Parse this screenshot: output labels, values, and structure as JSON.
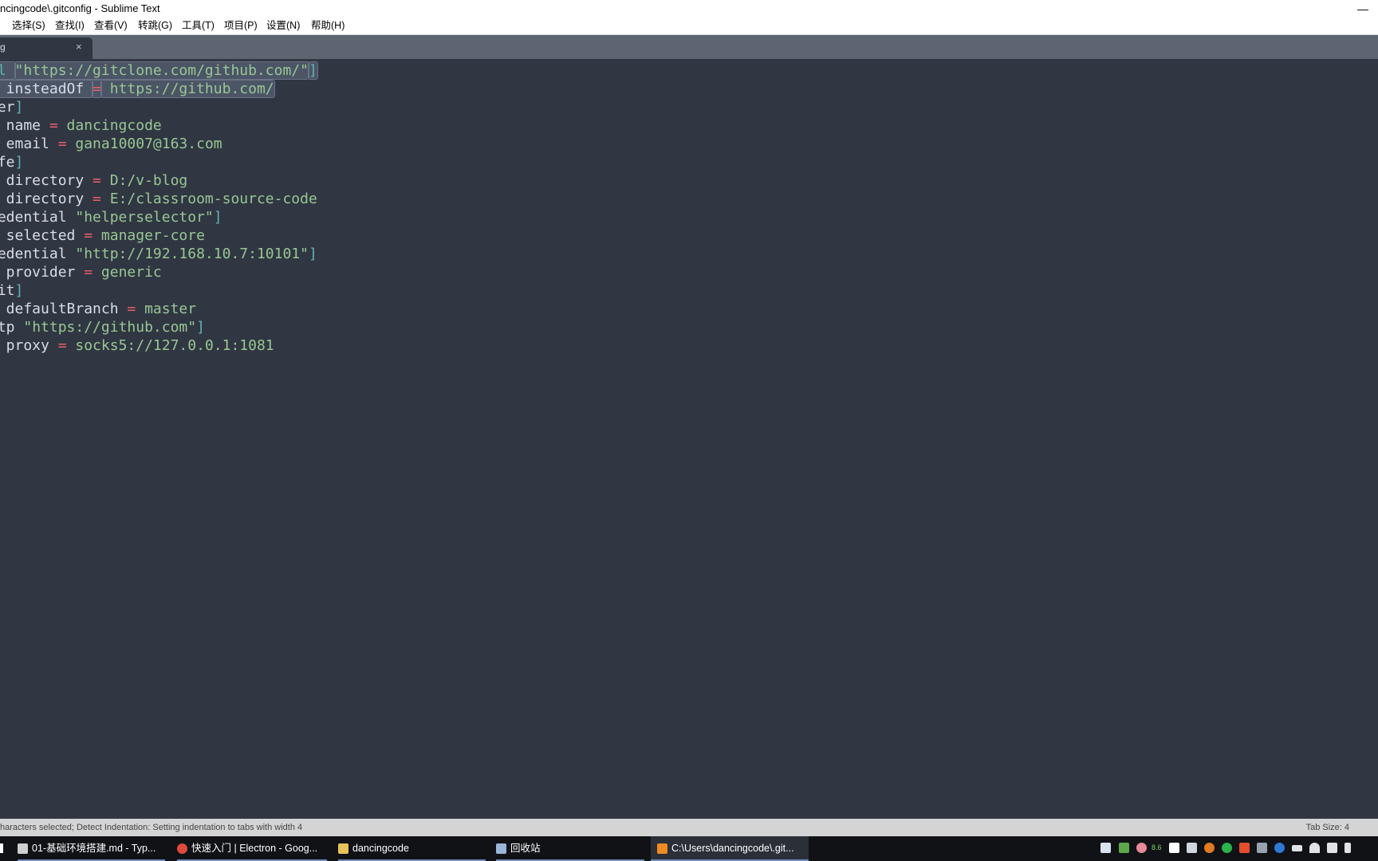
{
  "window": {
    "title": "ncingcode\\.gitconfig - Sublime Text"
  },
  "menu": [
    "选择(S)",
    "查找(I)",
    "查看(V)",
    "转跳(G)",
    "工具(T)",
    "项目(P)",
    "设置(N)",
    "帮助(H)"
  ],
  "tab": {
    "name": "g",
    "close": "×"
  },
  "code_lines": [
    [
      {
        "t": "rl ",
        "c": "b",
        "sel": true
      },
      {
        "t": "\"https://gitclone.com/github.com/\"",
        "c": "s",
        "sel": true
      },
      {
        "t": "]",
        "c": "b",
        "sel": true
      }
    ],
    [
      {
        "t": "  insteadOf ",
        "c": "k",
        "sel": true
      },
      {
        "t": "=",
        "c": "op",
        "sel": true
      },
      {
        "t": " https://github.com/",
        "c": "v",
        "sel": true
      }
    ],
    [
      {
        "t": "ser",
        "c": "k"
      },
      {
        "t": "]",
        "c": "b"
      }
    ],
    [
      {
        "t": "  name ",
        "c": "k"
      },
      {
        "t": "=",
        "c": "op"
      },
      {
        "t": " dancingcode",
        "c": "v"
      }
    ],
    [
      {
        "t": "  email ",
        "c": "k"
      },
      {
        "t": "=",
        "c": "op"
      },
      {
        "t": " gana10007@163.com",
        "c": "v"
      }
    ],
    [
      {
        "t": "afe",
        "c": "k"
      },
      {
        "t": "]",
        "c": "b"
      }
    ],
    [
      {
        "t": "  directory ",
        "c": "k"
      },
      {
        "t": "=",
        "c": "op"
      },
      {
        "t": " D:/v-blog",
        "c": "v"
      }
    ],
    [
      {
        "t": "  directory ",
        "c": "k"
      },
      {
        "t": "=",
        "c": "op"
      },
      {
        "t": " E:/classroom-source-code",
        "c": "v"
      }
    ],
    [
      {
        "t": "redential ",
        "c": "k"
      },
      {
        "t": "\"helperselector\"",
        "c": "s"
      },
      {
        "t": "]",
        "c": "b"
      }
    ],
    [
      {
        "t": "  selected ",
        "c": "k"
      },
      {
        "t": "=",
        "c": "op"
      },
      {
        "t": " manager-core",
        "c": "v"
      }
    ],
    [
      {
        "t": "redential ",
        "c": "k"
      },
      {
        "t": "\"http://192.168.10.7:10101\"",
        "c": "s"
      },
      {
        "t": "]",
        "c": "b"
      }
    ],
    [
      {
        "t": "  provider ",
        "c": "k"
      },
      {
        "t": "=",
        "c": "op"
      },
      {
        "t": " generic",
        "c": "v"
      }
    ],
    [
      {
        "t": "nit",
        "c": "k"
      },
      {
        "t": "]",
        "c": "b"
      }
    ],
    [
      {
        "t": "  defaultBranch ",
        "c": "k"
      },
      {
        "t": "=",
        "c": "op"
      },
      {
        "t": " master",
        "c": "v"
      }
    ],
    [
      {
        "t": "ttp ",
        "c": "k"
      },
      {
        "t": "\"https://github.com\"",
        "c": "s"
      },
      {
        "t": "]",
        "c": "b"
      }
    ],
    [
      {
        "t": "  proxy ",
        "c": "k"
      },
      {
        "t": "=",
        "c": "op"
      },
      {
        "t": " socks5://127.0.0.1:1081",
        "c": "v"
      }
    ]
  ],
  "status": {
    "left": "haracters selected; Detect Indentation: Setting indentation to tabs with width 4",
    "right": "Tab Size: 4"
  },
  "taskbar": {
    "items": [
      {
        "label": "01-基础环境搭建.md - Typ...",
        "color": "#cfcfcf"
      },
      {
        "label": "快速入门 | Electron - Goog...",
        "color": "#e04a3a"
      },
      {
        "label": "dancingcode",
        "color": "#e8c35a"
      },
      {
        "label": "回收站",
        "color": "#9db6d8"
      },
      {
        "label": "C:\\Users\\dancingcode\\.git...",
        "color": "#f08a24"
      }
    ],
    "tray_value": "8.6"
  }
}
